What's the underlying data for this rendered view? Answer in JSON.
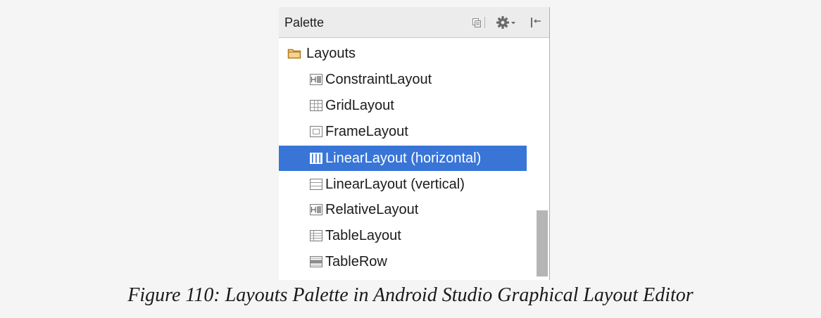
{
  "palette": {
    "title": "Palette",
    "toolbar": {
      "icons": [
        "copy-icon",
        "gear-dropdown-icon",
        "collapse-panel-icon"
      ]
    },
    "group": {
      "label": "Layouts",
      "icon": "folder-icon"
    },
    "items": [
      {
        "label": "ConstraintLayout",
        "icon": "constraint-layout-icon",
        "selected": false
      },
      {
        "label": "GridLayout",
        "icon": "grid-layout-icon",
        "selected": false
      },
      {
        "label": "FrameLayout",
        "icon": "frame-layout-icon",
        "selected": false
      },
      {
        "label": "LinearLayout (horizontal)",
        "icon": "linear-horizontal-icon",
        "selected": true
      },
      {
        "label": "LinearLayout (vertical)",
        "icon": "linear-vertical-icon",
        "selected": false
      },
      {
        "label": "RelativeLayout",
        "icon": "relative-layout-icon",
        "selected": false
      },
      {
        "label": "TableLayout",
        "icon": "table-layout-icon",
        "selected": false
      },
      {
        "label": "TableRow",
        "icon": "table-row-icon",
        "selected": false
      }
    ]
  },
  "colors": {
    "selection": "#3875d7",
    "folder": "#c9952b"
  },
  "caption": "Figure 110: Layouts Palette in Android Studio Graphical Layout Editor"
}
